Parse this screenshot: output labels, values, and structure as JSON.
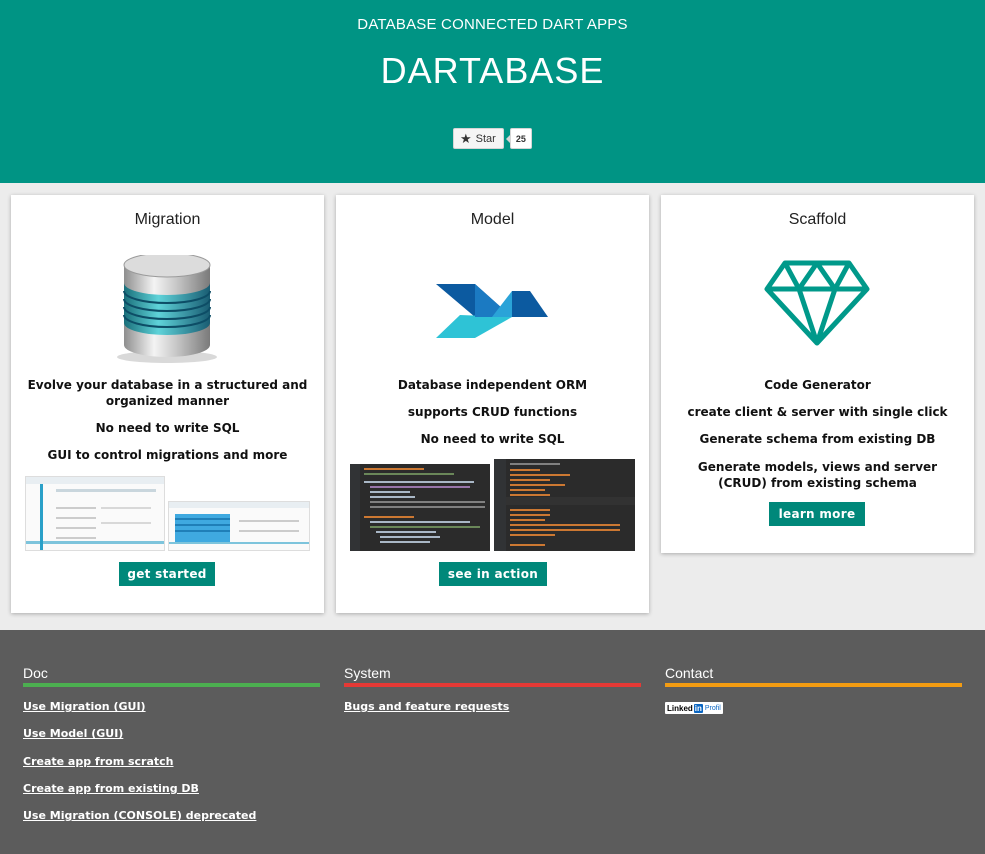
{
  "header": {
    "subtitle": "DATABASE CONNECTED DART APPS",
    "title": "DARTABASE",
    "github": {
      "star_label": "Star",
      "star_count": "25",
      "star_icon": "star-icon"
    }
  },
  "cards": [
    {
      "title": "Migration",
      "icon": "database-icon",
      "lines": [
        "Evolve your database in a structured and organized manner",
        "No need to write SQL",
        "GUI to control migrations and more"
      ],
      "button": "get started"
    },
    {
      "title": "Model",
      "icon": "dart-logo-icon",
      "lines": [
        "Database independent ORM",
        "supports CRUD functions",
        "No need to write SQL"
      ],
      "button": "see in action"
    },
    {
      "title": "Scaffold",
      "icon": "diamond-icon",
      "lines": [
        "Code Generator",
        "create client & server with single click",
        "Generate schema from existing DB",
        "Generate models, views and server (CRUD) from existing schema"
      ],
      "button": "learn more"
    }
  ],
  "footer": {
    "doc": {
      "heading": "Doc",
      "color": "#4caf50",
      "links": [
        "Use Migration (GUI)",
        "Use Model (GUI)",
        "Create app from scratch",
        "Create app from existing DB",
        "Use Migration (CONSOLE) deprecated"
      ]
    },
    "system": {
      "heading": "System",
      "color": "#e53935",
      "links": [
        "Bugs and feature requests"
      ]
    },
    "contact": {
      "heading": "Contact",
      "color": "#f39c12",
      "linkedin": {
        "a": "Linked",
        "b": "in",
        "c": "Profil"
      }
    }
  },
  "colors": {
    "header_bg": "#009484",
    "button_bg": "#00887a",
    "footer_bg": "#5c5c5c",
    "page_bg": "#ececec"
  }
}
